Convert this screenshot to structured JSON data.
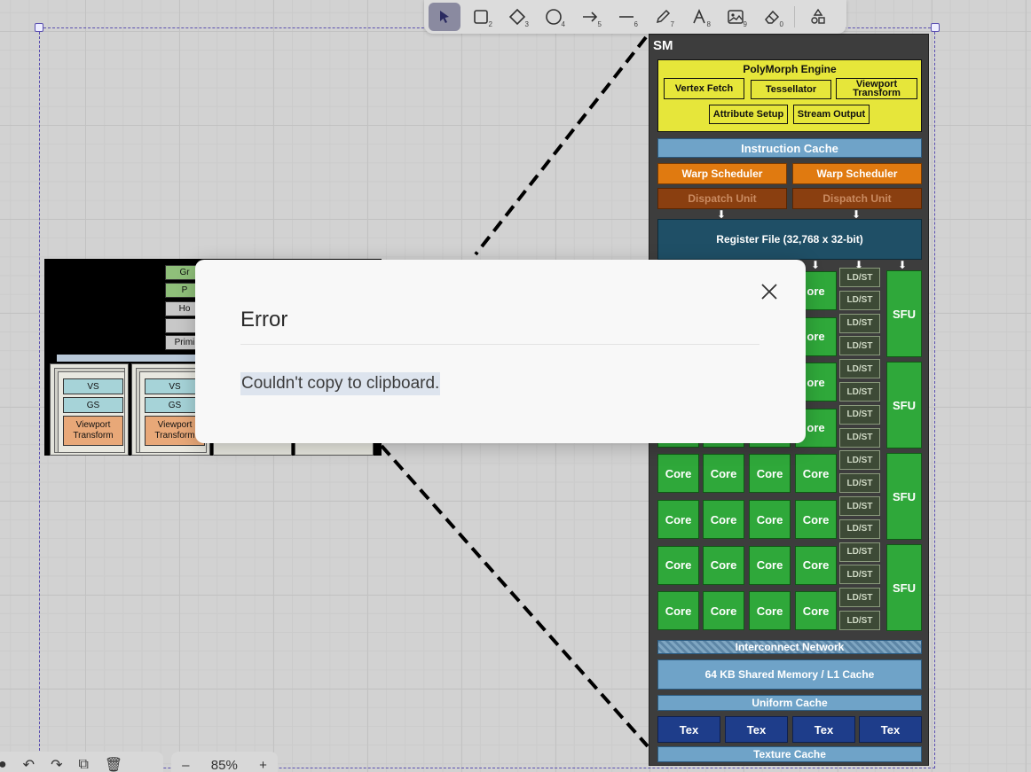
{
  "toolbar": {
    "tools": [
      {
        "name": "select",
        "key": ""
      },
      {
        "name": "rectangle",
        "key": "2"
      },
      {
        "name": "diamond",
        "key": "3"
      },
      {
        "name": "ellipse",
        "key": "4"
      },
      {
        "name": "arrow",
        "key": "5"
      },
      {
        "name": "line",
        "key": "6"
      },
      {
        "name": "draw",
        "key": "7"
      },
      {
        "name": "text",
        "key": "8"
      },
      {
        "name": "image",
        "key": "9"
      },
      {
        "name": "eraser",
        "key": "0"
      }
    ]
  },
  "zoom": {
    "minus": "–",
    "value": "85%",
    "plus": "+"
  },
  "dialog": {
    "title": "Error",
    "message": "Couldn't copy to clipboard."
  },
  "left_diagram": {
    "labels": [
      "Gr",
      "P",
      "Ho",
      "Primi"
    ],
    "units": [
      {
        "vs": "VS",
        "gs": "GS",
        "vt1": "Viewport",
        "vt2": "Transform"
      },
      {
        "vs": "VS",
        "gs": "GS",
        "vt1": "Viewport",
        "vt2": "Transform"
      }
    ]
  },
  "sm_diagram": {
    "title": "SM",
    "polymorph_title": "PolyMorph Engine",
    "vertex_fetch": "Vertex Fetch",
    "tessellator": "Tessellator",
    "viewport_transform": "Viewport Transform",
    "attribute_setup": "Attribute Setup",
    "stream_output": "Stream Output",
    "instruction_cache": "Instruction Cache",
    "warp_scheduler": "Warp Scheduler",
    "dispatch_unit": "Dispatch Unit",
    "register_file": "Register File (32,768 x 32-bit)",
    "core": "Core",
    "core_partial": "ore",
    "ldst": "LD/ST",
    "sfu": "SFU",
    "interconnect": "Interconnect Network",
    "shared_memory": "64 KB Shared Memory / L1 Cache",
    "uniform_cache": "Uniform Cache",
    "tex": "Tex",
    "texture_cache": "Texture Cache"
  }
}
